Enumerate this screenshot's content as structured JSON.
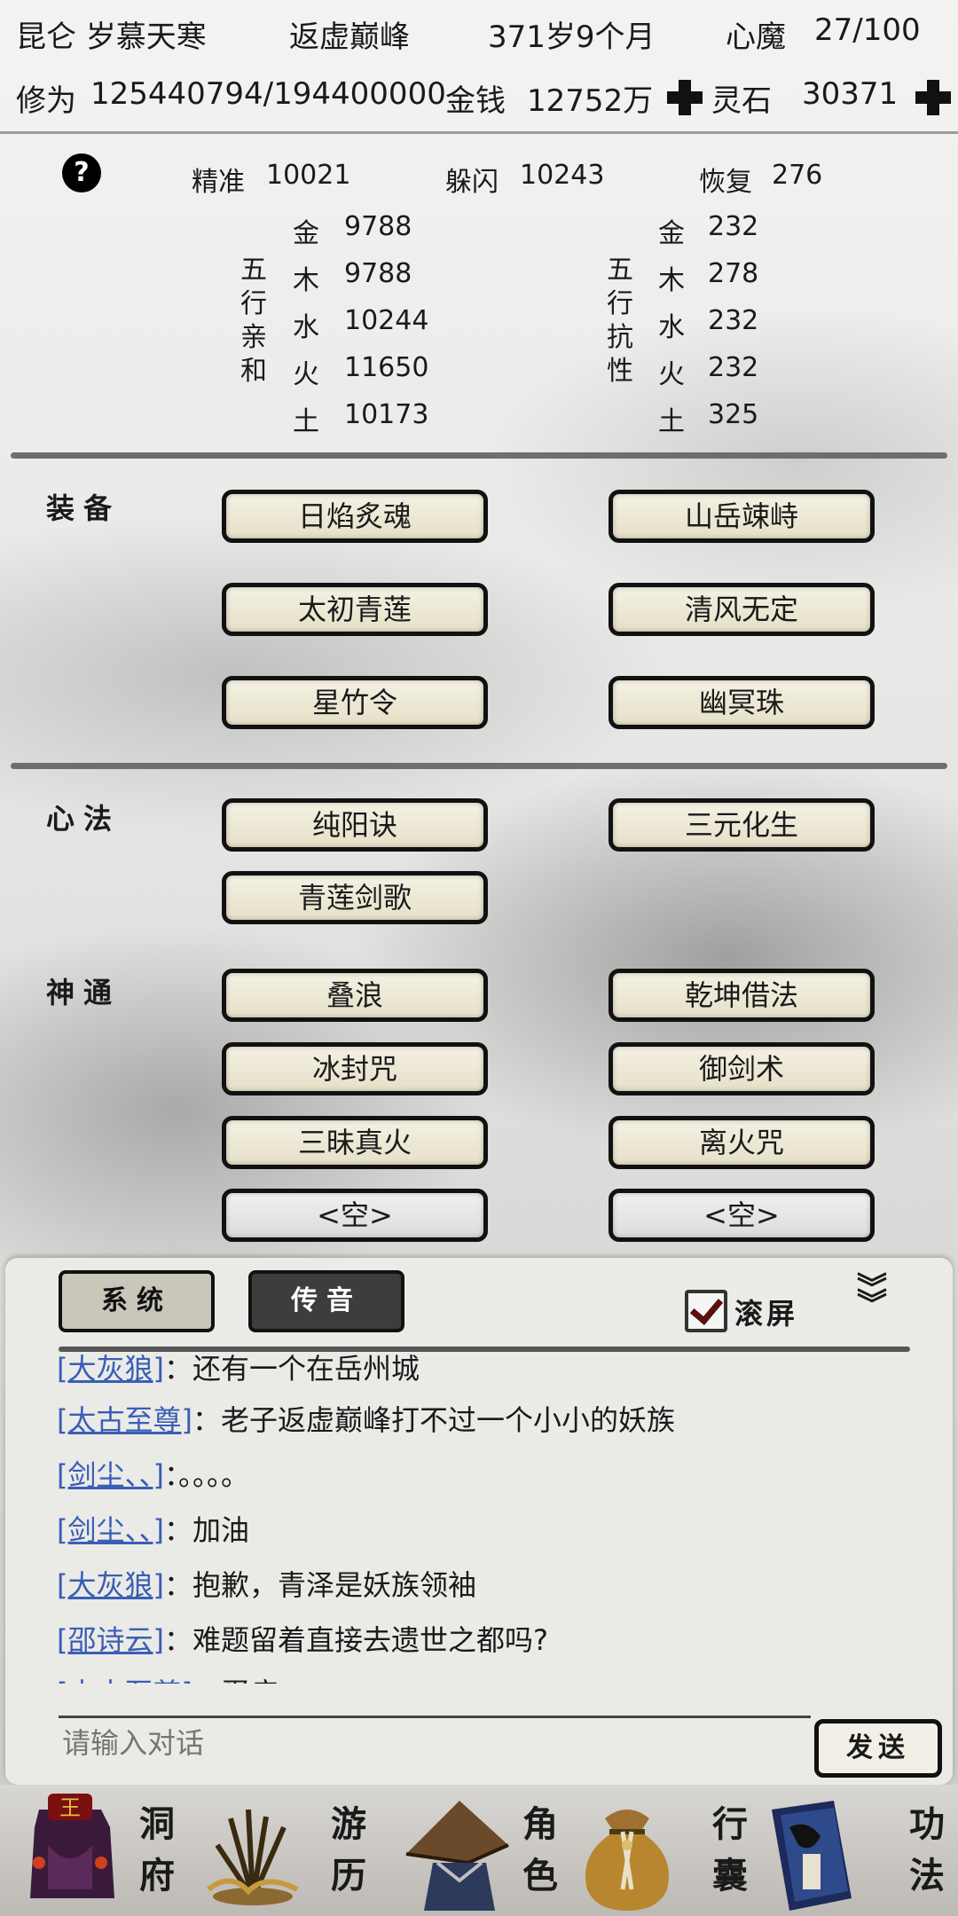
{
  "header": {
    "location": "昆仑 岁慕天寒",
    "realm": "返虚巅峰",
    "age": "371岁9个月",
    "heart_demon_label": "心魔",
    "heart_demon_value": "27/100",
    "cultivation_label": "修为",
    "cultivation_value": "125440794/194400000",
    "money_label": "金钱",
    "money_value": "12752万",
    "spirit_stone_label": "灵石",
    "spirit_stone_value": "30371"
  },
  "stats": {
    "accuracy_label": "精准",
    "accuracy": "10021",
    "dodge_label": "躲闪",
    "dodge": "10243",
    "recover_label": "恢复",
    "recover": "276",
    "affinity_title": "五行亲和",
    "resist_title": "五行抗性",
    "elements": [
      "金",
      "木",
      "水",
      "火",
      "土"
    ],
    "affinity_values": [
      "9788",
      "9788",
      "10244",
      "11650",
      "10173"
    ],
    "resist_values": [
      "232",
      "278",
      "232",
      "232",
      "325"
    ]
  },
  "equipment": {
    "label": "装备",
    "items": [
      "日焰炙魂",
      "山岳竦峙",
      "太初青莲",
      "清风无定",
      "星竹令",
      "幽冥珠"
    ]
  },
  "mind_methods": {
    "label": "心法",
    "items": [
      "纯阳诀",
      "三元化生",
      "青莲剑歌"
    ]
  },
  "divine_powers": {
    "label": "神通",
    "items": [
      "叠浪",
      "乾坤借法",
      "冰封咒",
      "御剑术",
      "三昧真火",
      "离火咒",
      "<空>",
      "<空>"
    ]
  },
  "chat": {
    "tab_system": "系统",
    "tab_voice": "传音",
    "scroll_label": "滚屏",
    "scroll_checked": true,
    "messages": [
      {
        "name": "[大灰狼]",
        "text": "：还有一个在岳州城"
      },
      {
        "name": "[太古至尊]",
        "text": "：老子返虚巅峰打不过一个小小的妖族"
      },
      {
        "name": "[剑尘、、]",
        "text": "：。。。。"
      },
      {
        "name": "[剑尘、、]",
        "text": "：加油"
      },
      {
        "name": "[大灰狼]",
        "text": "：抱歉，青泽是妖族领袖"
      },
      {
        "name": "[邵诗云]",
        "text": "：难题留着直接去遗世之都吗?"
      },
      {
        "name": "[太古至尊]",
        "text": "：蛋疼"
      }
    ],
    "input_placeholder": "请输入对话",
    "send_label": "发送"
  },
  "nav": {
    "items": [
      {
        "label": "洞府",
        "icon": "cave-dwelling-icon"
      },
      {
        "label": "游历",
        "icon": "travel-icon"
      },
      {
        "label": "角色",
        "icon": "character-icon"
      },
      {
        "label": "行囊",
        "icon": "bag-icon"
      },
      {
        "label": "功法",
        "icon": "scripture-icon"
      }
    ]
  },
  "colors": {
    "chat_name": "#3a5eb5",
    "button_bg": "#f4f1e4",
    "active_tab": "#3d3d3d"
  }
}
